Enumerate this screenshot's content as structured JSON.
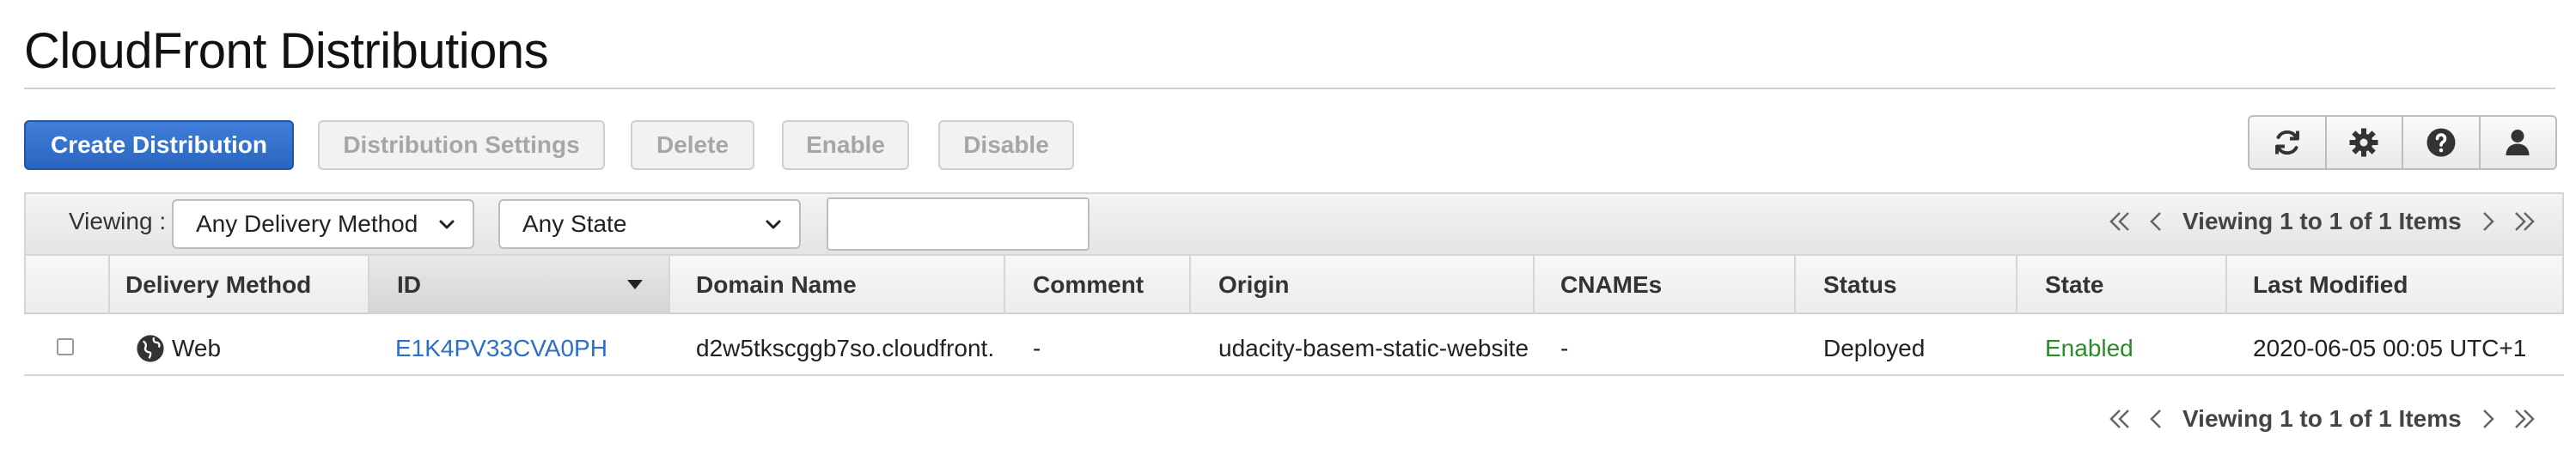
{
  "page": {
    "title": "CloudFront Distributions"
  },
  "toolbar": {
    "create_label": "Create Distribution",
    "settings_label": "Distribution Settings",
    "delete_label": "Delete",
    "enable_label": "Enable",
    "disable_label": "Disable",
    "icons": [
      "refresh-icon",
      "gear-icon",
      "help-icon",
      "user-icon"
    ]
  },
  "filters": {
    "viewing_label": "Viewing :",
    "delivery_method": "Any Delivery Method",
    "state": "Any State",
    "search_value": ""
  },
  "pager": {
    "text": "Viewing 1 to 1 of 1 Items"
  },
  "table": {
    "columns": [
      "Delivery Method",
      "ID",
      "Domain Name",
      "Comment",
      "Origin",
      "CNAMEs",
      "Status",
      "State",
      "Last Modified"
    ],
    "rows": [
      {
        "delivery_method": "Web",
        "id": "E1K4PV33CVA0PH",
        "domain_name": "d2w5tkscggb7so.cloudfront.",
        "comment": "-",
        "origin": "udacity-basem-static-website",
        "cnames": "-",
        "status": "Deployed",
        "state": "Enabled",
        "last_modified": "2020-06-05 00:05 UTC+1"
      }
    ]
  },
  "colors": {
    "primary_button": "#2b66be",
    "link": "#2d6ec7",
    "enabled": "#2b8a2b"
  }
}
